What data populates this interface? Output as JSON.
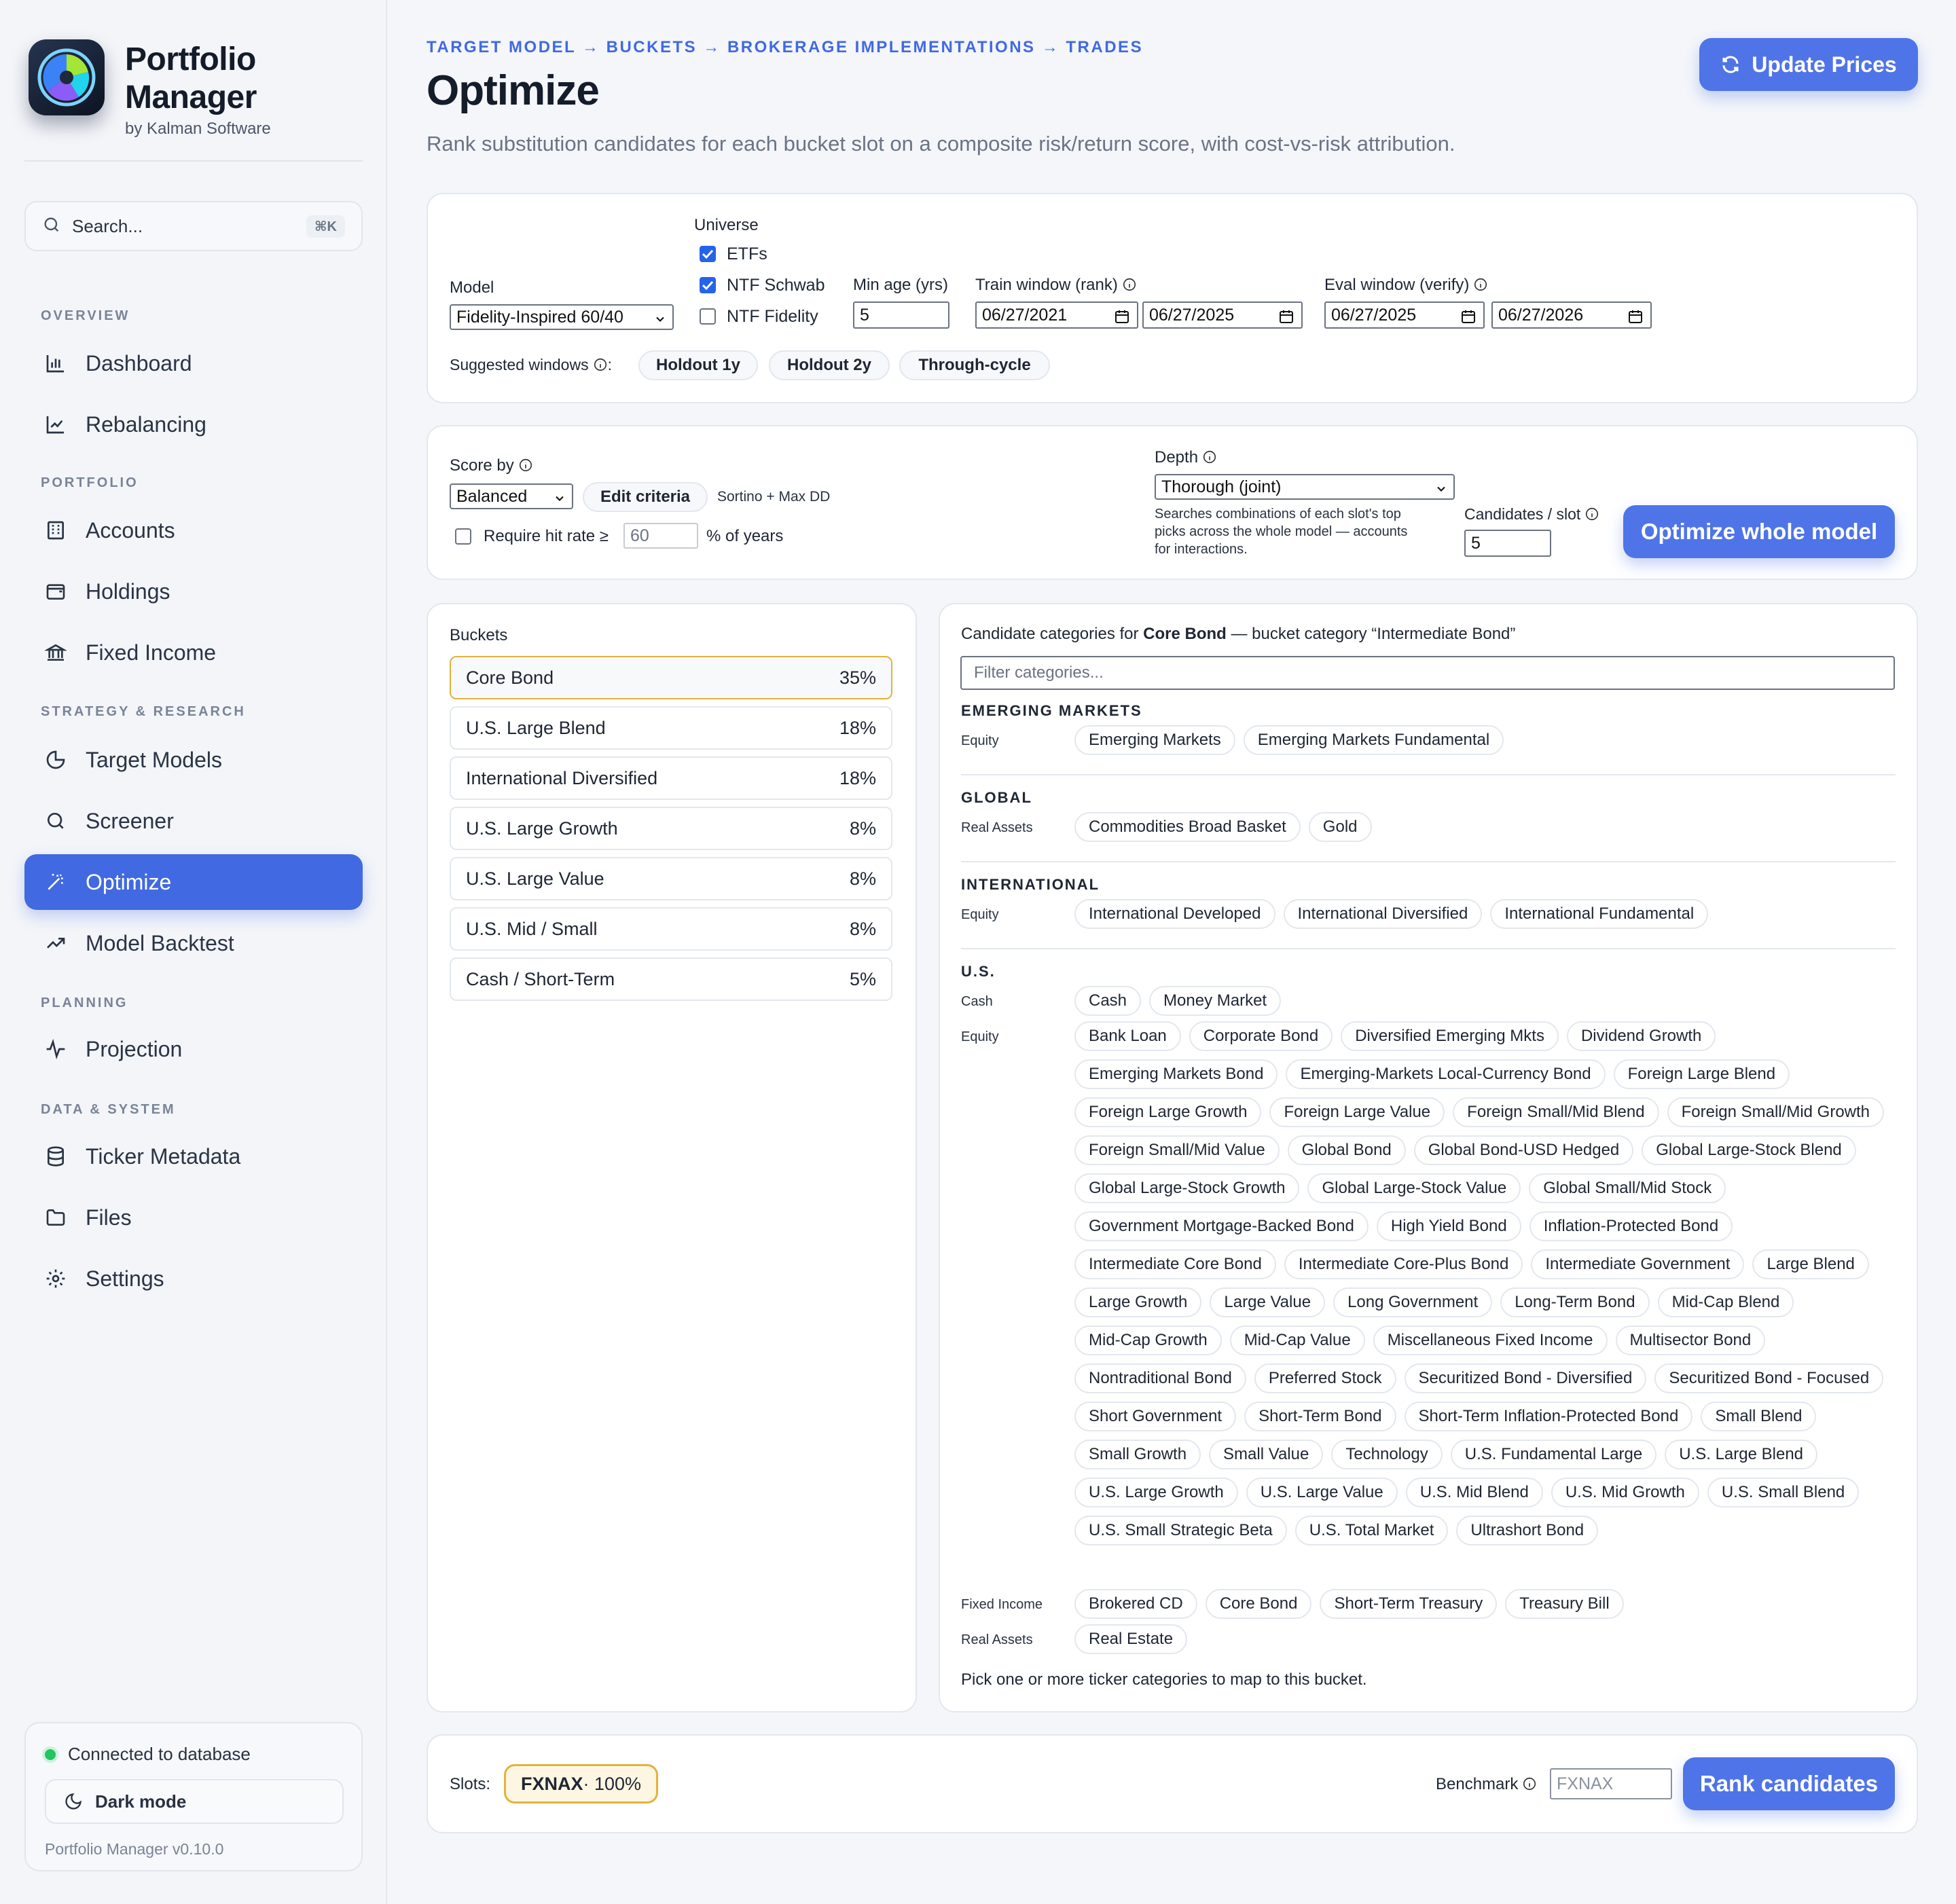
{
  "app": {
    "title_line1": "Portfolio",
    "title_line2": "Manager",
    "subtitle": "by Kalman Software"
  },
  "search": {
    "label": "Search...",
    "shortcut": "⌘K"
  },
  "nav": {
    "sections": [
      "OVERVIEW",
      "PORTFOLIO",
      "STRATEGY & RESEARCH",
      "PLANNING",
      "DATA & SYSTEM"
    ],
    "items": [
      {
        "label": "Dashboard",
        "icon": "bar-chart-icon"
      },
      {
        "label": "Rebalancing",
        "icon": "line-chart-icon"
      },
      {
        "label": "Accounts",
        "icon": "building-icon"
      },
      {
        "label": "Holdings",
        "icon": "wallet-icon"
      },
      {
        "label": "Fixed Income",
        "icon": "bank-icon"
      },
      {
        "label": "Target Models",
        "icon": "pie-chart-icon"
      },
      {
        "label": "Screener",
        "icon": "search-icon"
      },
      {
        "label": "Optimize",
        "icon": "magic-wand-icon",
        "active": true
      },
      {
        "label": "Model Backtest",
        "icon": "trending-up-icon"
      },
      {
        "label": "Projection",
        "icon": "activity-icon"
      },
      {
        "label": "Ticker Metadata",
        "icon": "database-icon"
      },
      {
        "label": "Files",
        "icon": "folder-icon"
      },
      {
        "label": "Settings",
        "icon": "gear-icon"
      }
    ]
  },
  "status": {
    "connection": "Connected to database",
    "dark_mode": "Dark mode",
    "version": "Portfolio Manager v0.10.0"
  },
  "header": {
    "breadcrumb": "TARGET MODEL → BUCKETS → BROKERAGE IMPLEMENTATIONS → TRADES",
    "title": "Optimize",
    "description": "Rank substitution candidates for each bucket slot on a composite risk/return score, with cost-vs-risk attribution.",
    "update_prices": "Update Prices"
  },
  "config": {
    "model_label": "Model",
    "model_value": "Fidelity-Inspired 60/40",
    "universe_label": "Universe",
    "universe": [
      {
        "label": "ETFs",
        "checked": true
      },
      {
        "label": "NTF Schwab",
        "checked": true
      },
      {
        "label": "NTF Fidelity",
        "checked": false
      }
    ],
    "min_age_label": "Min age (yrs)",
    "min_age_value": "5",
    "train_label": "Train window (rank)",
    "train_start": "06/27/2021",
    "train_end": "06/27/2025",
    "eval_label": "Eval window (verify)",
    "eval_start": "06/27/2025",
    "eval_end": "06/27/2026",
    "suggested_label": "Suggested windows",
    "suggested": [
      "Holdout 1y",
      "Holdout 2y",
      "Through-cycle"
    ]
  },
  "scoring": {
    "score_by_label": "Score by",
    "score_by_value": "Balanced",
    "edit_criteria": "Edit criteria",
    "criteria_summary": "Sortino + Max DD",
    "hit_rate_label": "Require hit rate ≥",
    "hit_rate_value": "60",
    "hit_rate_suffix": "% of years",
    "depth_label": "Depth",
    "depth_value": "Thorough (joint)",
    "depth_help": [
      "Searches combinations of each slot's top",
      "picks across the whole model — accounts",
      "for interactions."
    ],
    "candidates_label": "Candidates / slot",
    "candidates_value": "5",
    "optimize_button": "Optimize whole model"
  },
  "buckets": {
    "title": "Buckets",
    "items": [
      {
        "name": "Core Bond",
        "pct": "35%",
        "selected": true
      },
      {
        "name": "U.S. Large Blend",
        "pct": "18%"
      },
      {
        "name": "International Diversified",
        "pct": "18%"
      },
      {
        "name": "U.S. Large Growth",
        "pct": "8%"
      },
      {
        "name": "U.S. Large Value",
        "pct": "8%"
      },
      {
        "name": "U.S. Mid / Small",
        "pct": "8%"
      },
      {
        "name": "Cash / Short-Term",
        "pct": "5%"
      }
    ]
  },
  "candidates": {
    "header_prefix": "Candidate categories for ",
    "header_bucket": "Core Bond",
    "header_suffix": " — bucket category “Intermediate Bond”",
    "filter_placeholder": "Filter categories...",
    "groups": [
      {
        "title": "EMERGING MARKETS",
        "rows": [
          {
            "label": "Equity",
            "chips": [
              "Emerging Markets",
              "Emerging Markets Fundamental"
            ]
          }
        ]
      },
      {
        "title": "GLOBAL",
        "rows": [
          {
            "label": "Real Assets",
            "chips": [
              "Commodities Broad Basket",
              "Gold"
            ]
          }
        ]
      },
      {
        "title": "INTERNATIONAL",
        "rows": [
          {
            "label": "Equity",
            "chips": [
              "International Developed",
              "International Diversified",
              "International Fundamental"
            ]
          }
        ]
      },
      {
        "title": "U.S.",
        "rows": [
          {
            "label": "Cash",
            "chips": [
              "Cash",
              "Money Market"
            ]
          },
          {
            "label": "Equity",
            "chips": [
              "Bank Loan",
              "Corporate Bond",
              "Diversified Emerging Mkts",
              "Dividend Growth",
              "Emerging Markets Bond",
              "Emerging-Markets Local-Currency Bond",
              "Foreign Large Blend",
              "Foreign Large Growth",
              "Foreign Large Value",
              "Foreign Small/Mid Blend",
              "Foreign Small/Mid Growth",
              "Foreign Small/Mid Value",
              "Global Bond",
              "Global Bond-USD Hedged",
              "Global Large-Stock Blend",
              "Global Large-Stock Growth",
              "Global Large-Stock Value",
              "Global Small/Mid Stock",
              "Government Mortgage-Backed Bond",
              "High Yield Bond",
              "Inflation-Protected Bond",
              "Intermediate Core Bond",
              "Intermediate Core-Plus Bond",
              "Intermediate Government",
              "Large Blend",
              "Large Growth",
              "Large Value",
              "Long Government",
              "Long-Term Bond",
              "Mid-Cap Blend",
              "Mid-Cap Growth",
              "Mid-Cap Value",
              "Miscellaneous Fixed Income",
              "Multisector Bond",
              "Nontraditional Bond",
              "Preferred Stock",
              "Securitized Bond - Diversified",
              "Securitized Bond - Focused",
              "Short Government",
              "Short-Term Bond",
              "Short-Term Inflation-Protected Bond",
              "Small Blend",
              "Small Growth",
              "Small Value",
              "Technology",
              "U.S. Fundamental Large",
              "U.S. Large Blend",
              "U.S. Large Growth",
              "U.S. Large Value",
              "U.S. Mid Blend",
              "U.S. Mid Growth",
              "U.S. Small Blend",
              "U.S. Small Strategic Beta",
              "U.S. Total Market",
              "Ultrashort Bond"
            ]
          },
          {
            "label": "Fixed Income",
            "chips": [
              "Brokered CD",
              "Core Bond",
              "Short-Term Treasury",
              "Treasury Bill"
            ]
          },
          {
            "label": "Real Assets",
            "chips": [
              "Real Estate"
            ]
          }
        ]
      }
    ],
    "hint": "Pick one or more ticker categories to map to this bucket."
  },
  "slots": {
    "label": "Slots:",
    "ticker": "FXNAX",
    "weight": " · 100%",
    "benchmark_label": "Benchmark",
    "benchmark_placeholder": "FXNAX",
    "rank_button": "Rank candidates"
  },
  "colors": {
    "accent": "#4169e1",
    "selected_border": "#e2b23c",
    "status_ok": "#22c55e"
  }
}
